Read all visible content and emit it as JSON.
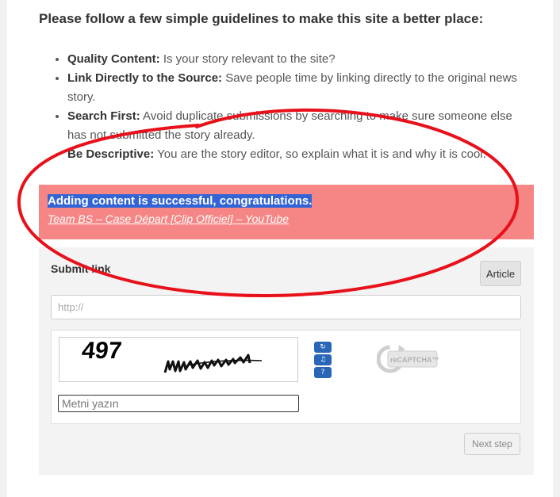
{
  "heading": "Please follow a few simple guidelines to make this site a better place:",
  "guidelines": [
    {
      "term": "Quality Content:",
      "text": " Is your story relevant to the site?"
    },
    {
      "term": "Link Directly to the Source:",
      "text": " Save people time by linking directly to the original news story."
    },
    {
      "term": "Search First:",
      "text": " Avoid duplicate submissions by searching to make sure someone else has not submitted the story already."
    },
    {
      "term": "Be Descriptive:",
      "text": " You are the story editor, so explain what it is and why it is cool."
    }
  ],
  "notice": {
    "message": "Adding content is successful, congratulations.",
    "link": "Team BS – Case Départ [Clip Officiel] – YouTube"
  },
  "submit_panel": {
    "title": "Submit link",
    "article_button": "Article",
    "url_placeholder": "http://",
    "next_button": "Next step"
  },
  "captcha": {
    "challenge_text": "497",
    "input_placeholder": "Metni yazın",
    "logo_text": "reCAPTCHA™",
    "logo_prefix": "re",
    "refresh_icon": "refresh-icon",
    "audio_icon": "audio-icon",
    "help_icon": "help-icon"
  },
  "colors": {
    "notice_bg": "#f58685",
    "selection": "#3264d6",
    "annotation": "#e8101a",
    "button_blue": "#2a66b8"
  }
}
